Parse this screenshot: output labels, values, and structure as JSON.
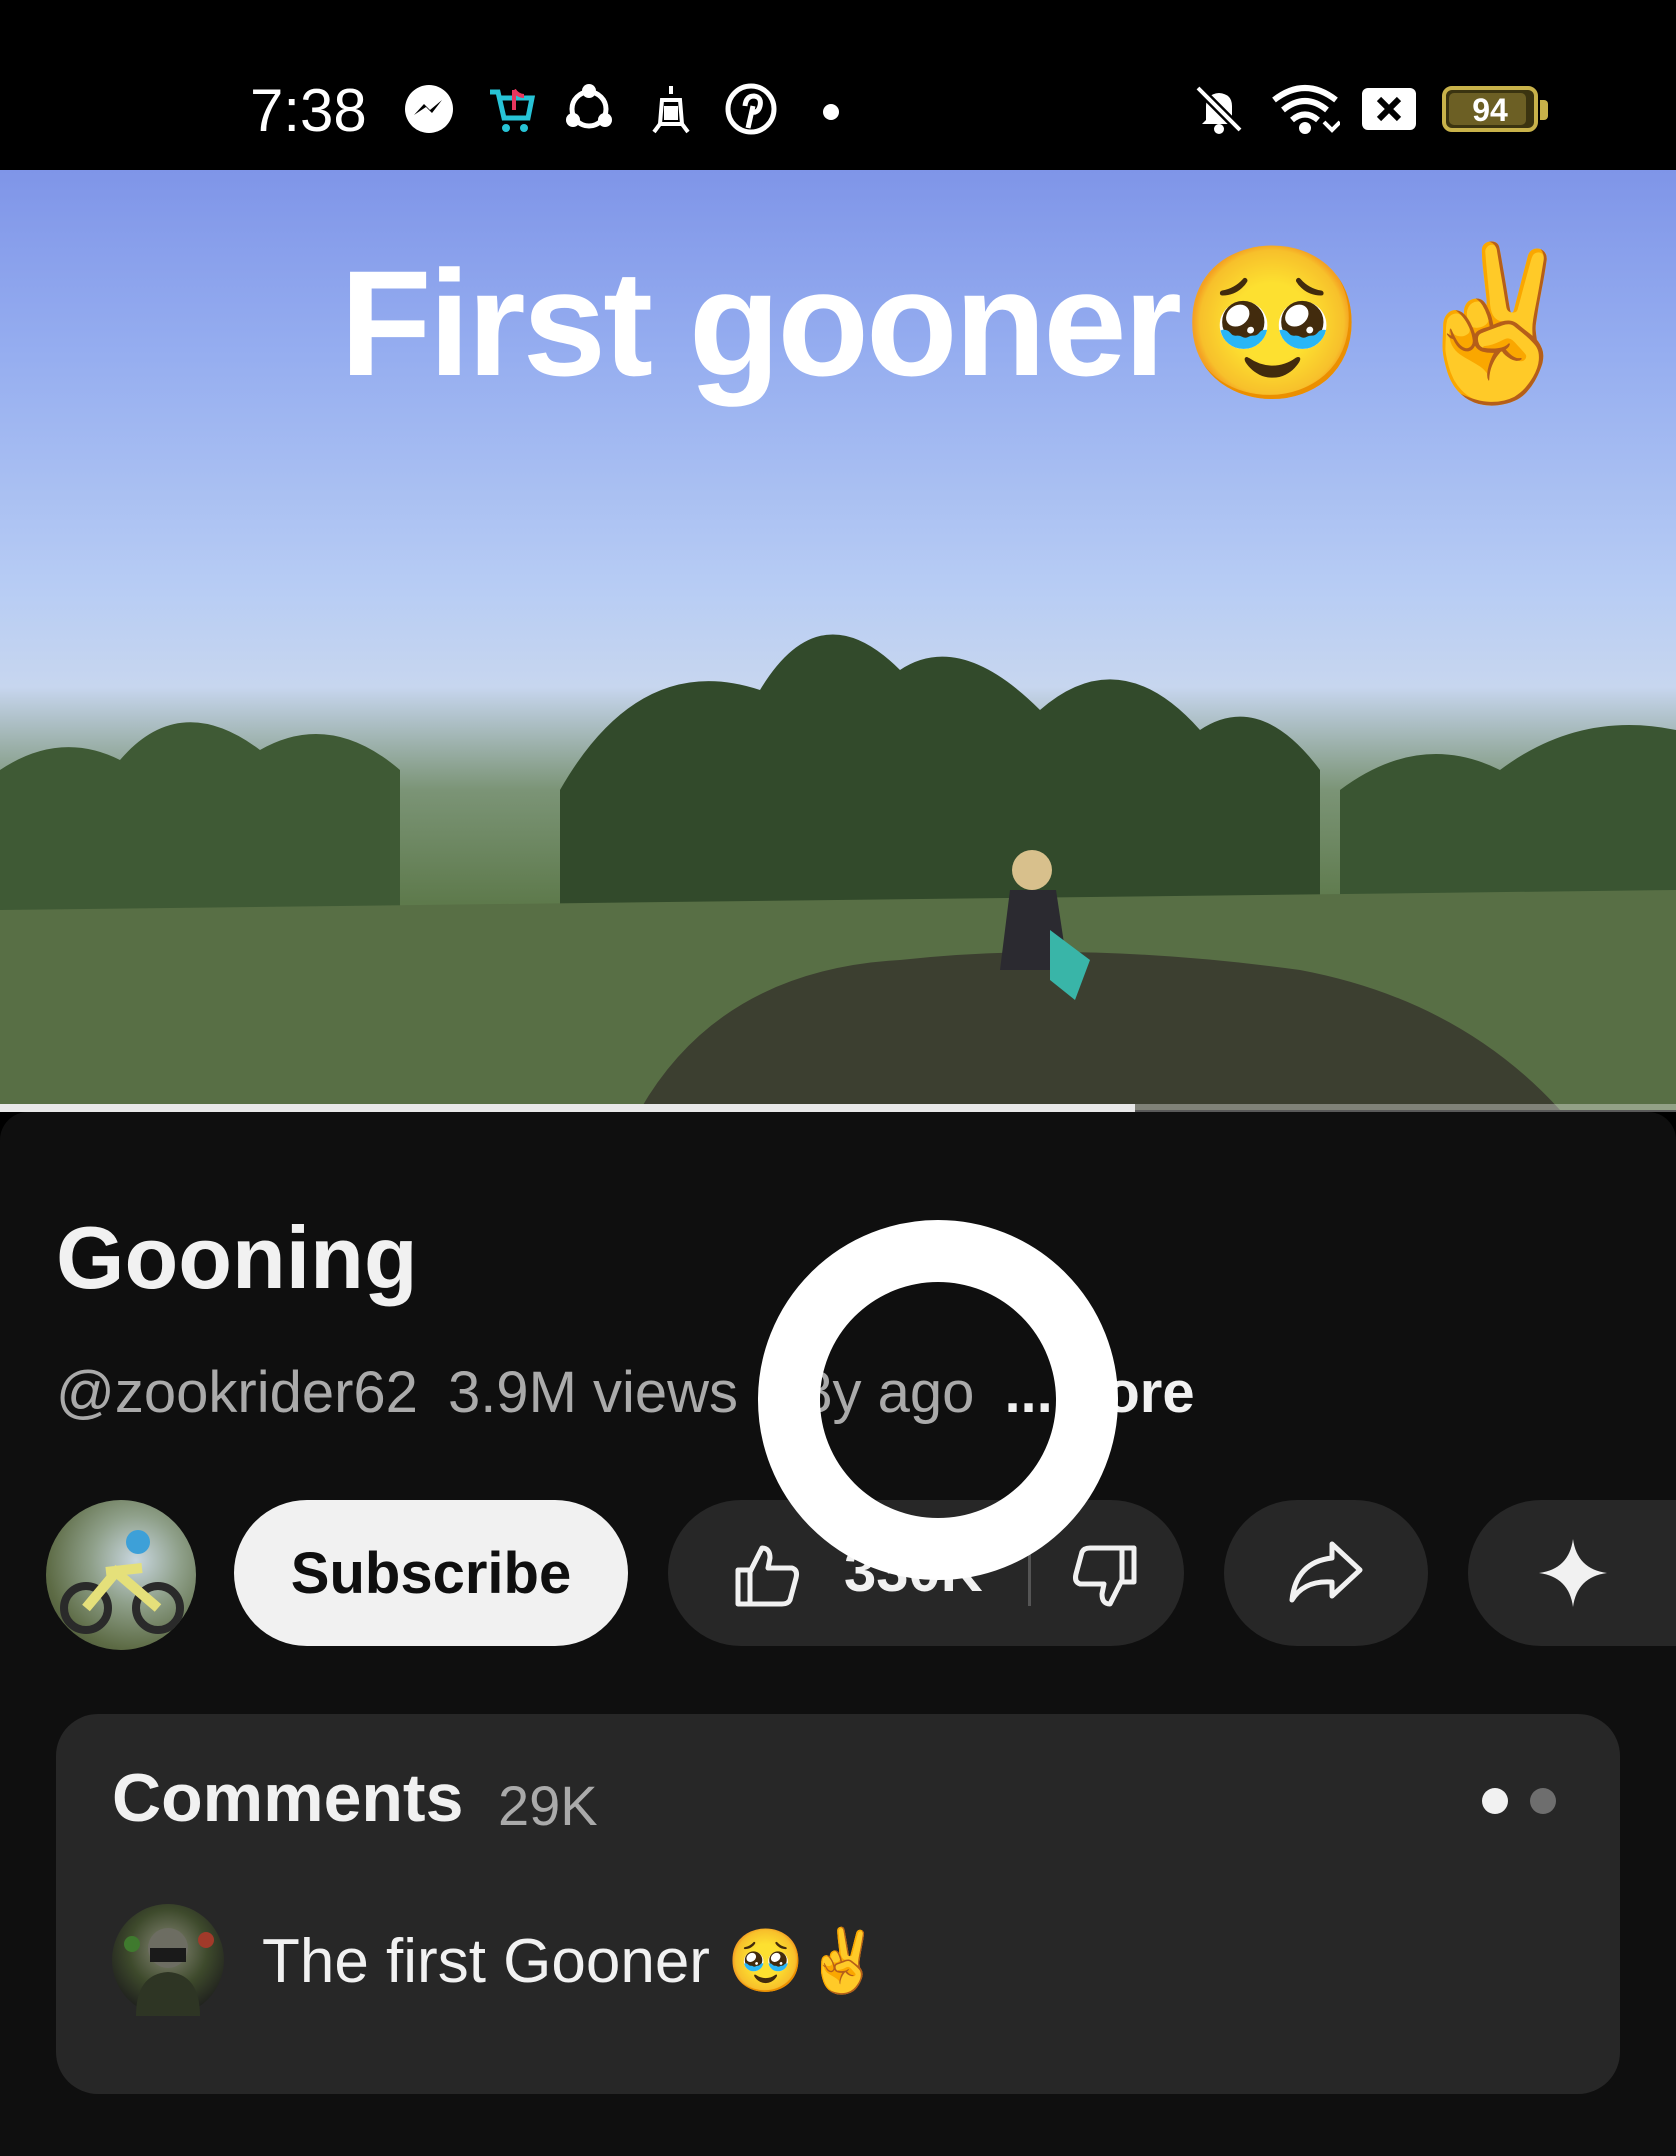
{
  "status_bar": {
    "time": "7:38",
    "left_icons": [
      "messenger-icon",
      "tiktok-shop-icon",
      "share-hub-icon",
      "rocket-icon",
      "pinterest-icon",
      "more-notifications-dot"
    ],
    "right_icons": [
      "silent-bell-icon",
      "wifi-icon",
      "close-box-icon",
      "battery-icon"
    ],
    "battery_level": "94",
    "battery_fraction": 0.94
  },
  "video": {
    "overlay_text": "First gooner🥹 ✌️",
    "progress": 0.677
  },
  "video_info": {
    "title": "Gooning",
    "channel_handle": "@zookrider62",
    "views": "3.9M views",
    "age": "18y ago",
    "more_label": "...more"
  },
  "actions": {
    "subscribe_label": "Subscribe",
    "like_count": "330K",
    "icons": [
      "thumbs-up-icon",
      "thumbs-down-icon",
      "share-icon",
      "remix-sparkle-icon"
    ]
  },
  "comments": {
    "title": "Comments",
    "count": "29K",
    "pager": {
      "total": 2,
      "active": 1
    },
    "top_comment": "The first Gooner 🥹✌️"
  },
  "colors": {
    "background": "#0f0f0f",
    "pill": "#272727",
    "subscribe_bg": "#f1f1f1",
    "secondary_text": "#aaaaaa",
    "battery": "#c8b24a"
  }
}
